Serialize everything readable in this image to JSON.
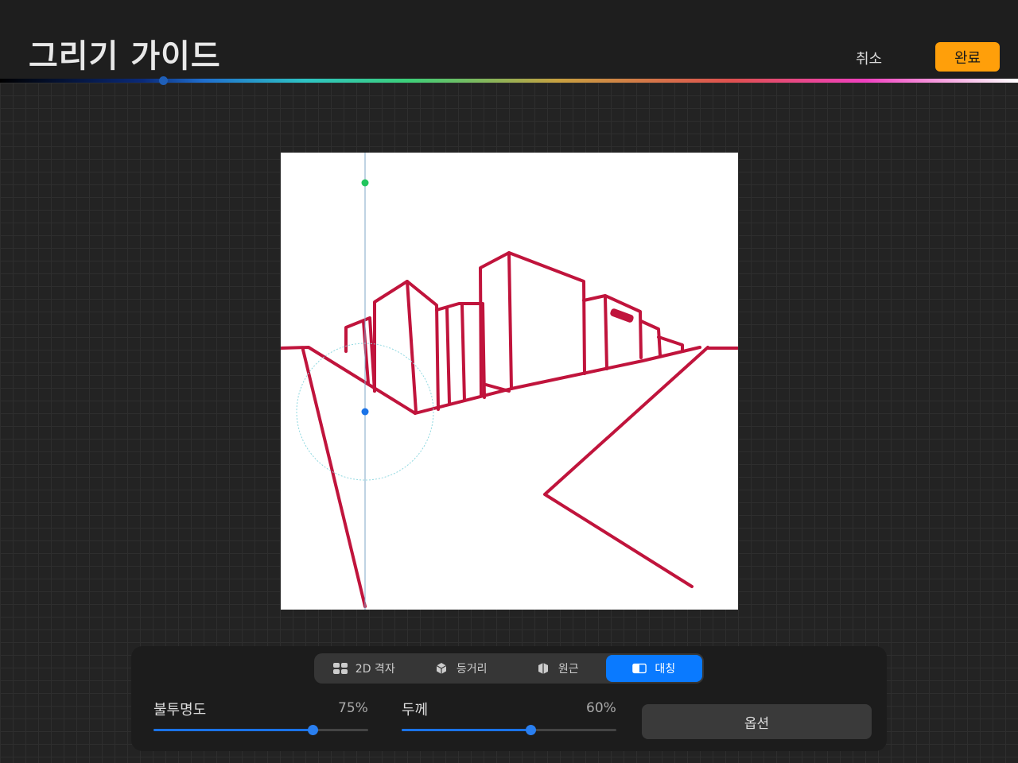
{
  "header": {
    "title": "그리기 가이드",
    "cancel_label": "취소",
    "done_label": "완료"
  },
  "guide_modes": [
    {
      "label": "2D 격자",
      "icon": "grid-icon",
      "active": false
    },
    {
      "label": "등거리",
      "icon": "isometric-cube-icon",
      "active": false
    },
    {
      "label": "원근",
      "icon": "perspective-icon",
      "active": false
    },
    {
      "label": "대칭",
      "icon": "symmetry-icon",
      "active": true
    }
  ],
  "sliders": {
    "opacity": {
      "label": "불투명도",
      "value_text": "75%",
      "value": 75
    },
    "thickness": {
      "label": "두께",
      "value_text": "60%",
      "value": 60
    }
  },
  "options_label": "옵션",
  "colors": {
    "accent": "#0a7aff",
    "done": "#ff9f0a",
    "stroke": "#c0143c"
  }
}
